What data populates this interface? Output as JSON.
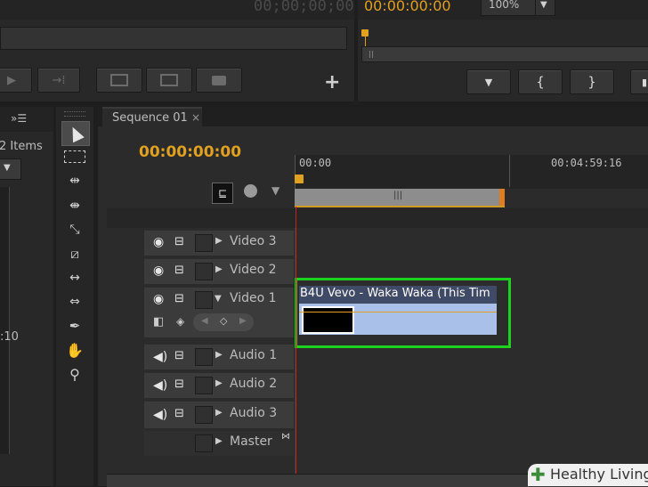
{
  "source_monitor": {
    "timecode": "00;00;00;00"
  },
  "program_monitor": {
    "timecode": "00:00:00:00",
    "zoom": "100%"
  },
  "project_panel": {
    "items_count": "2 Items",
    "duration_fragment": ":10"
  },
  "sequence": {
    "tab_label": "Sequence 01",
    "close_glyph": "×",
    "timecode": "00:00:00:00",
    "ruler_start": "00:00",
    "ruler_mark": "00:04:59:16",
    "tracks": [
      {
        "label": "Video 3"
      },
      {
        "label": "Video 2"
      },
      {
        "label": "Video 1"
      },
      {
        "label": "Audio 1"
      },
      {
        "label": "Audio 2"
      },
      {
        "label": "Audio 3"
      },
      {
        "label": "Master"
      }
    ],
    "clip_title": "B4U Vevo - Waka Waka (This Tim"
  },
  "watermark": {
    "brand": "Healthy Living"
  },
  "colors": {
    "accent": "#e0a020",
    "playhead": "#cc2020",
    "highlight": "#1fd11f",
    "clip": "#a9c0e8"
  }
}
